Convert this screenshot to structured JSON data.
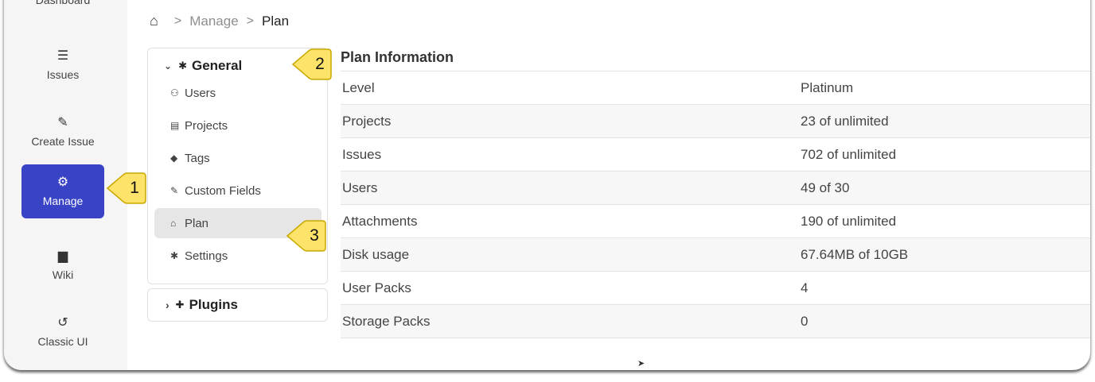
{
  "sidebar": {
    "items": [
      {
        "label": "Dashboard",
        "icon": "dashboard-icon",
        "glyph": ""
      },
      {
        "label": "Issues",
        "icon": "list-icon",
        "glyph": "☰"
      },
      {
        "label": "Create Issue",
        "icon": "edit-icon",
        "glyph": "✎"
      },
      {
        "label": "Manage",
        "icon": "gears-icon",
        "glyph": "⚙"
      },
      {
        "label": "Wiki",
        "icon": "file-icon",
        "glyph": "▆"
      },
      {
        "label": "Classic UI",
        "icon": "history-icon",
        "glyph": "↺"
      }
    ],
    "active_color": "#3943c6"
  },
  "breadcrumb": {
    "home_glyph": "⌂",
    "sep": ">",
    "manage": "Manage",
    "current": "Plan"
  },
  "menu": {
    "general_label": "General",
    "general_chevron": "⌄",
    "general_glyph": "✱",
    "items": [
      {
        "label": "Users",
        "icon": "users-icon",
        "glyph": "⚇"
      },
      {
        "label": "Projects",
        "icon": "table-icon",
        "glyph": "▤"
      },
      {
        "label": "Tags",
        "icon": "tags-icon",
        "glyph": "◆"
      },
      {
        "label": "Custom Fields",
        "icon": "pencil-icon",
        "glyph": "✎"
      },
      {
        "label": "Plan",
        "icon": "bank-icon",
        "glyph": "⌂"
      },
      {
        "label": "Settings",
        "icon": "gear-icon",
        "glyph": "✱"
      }
    ],
    "plugins_label": "Plugins",
    "plugins_chevron": "›",
    "plugins_glyph": "✚"
  },
  "plan": {
    "title": "Plan Information",
    "rows": [
      {
        "key": "Level",
        "value": "Platinum"
      },
      {
        "key": "Projects",
        "value": "23 of unlimited"
      },
      {
        "key": "Issues",
        "value": "702 of unlimited"
      },
      {
        "key": "Users",
        "value": "49 of 30"
      },
      {
        "key": "Attachments",
        "value": "190 of unlimited"
      },
      {
        "key": "Disk usage",
        "value": "67.64MB of 10GB"
      },
      {
        "key": "User Packs",
        "value": "4"
      },
      {
        "key": "Storage Packs",
        "value": "0"
      }
    ]
  },
  "callouts": [
    {
      "number": "1",
      "color": "#fde36a"
    },
    {
      "number": "2",
      "color": "#fde36a"
    },
    {
      "number": "3",
      "color": "#fde36a"
    }
  ],
  "cursor_glyph": "➤"
}
